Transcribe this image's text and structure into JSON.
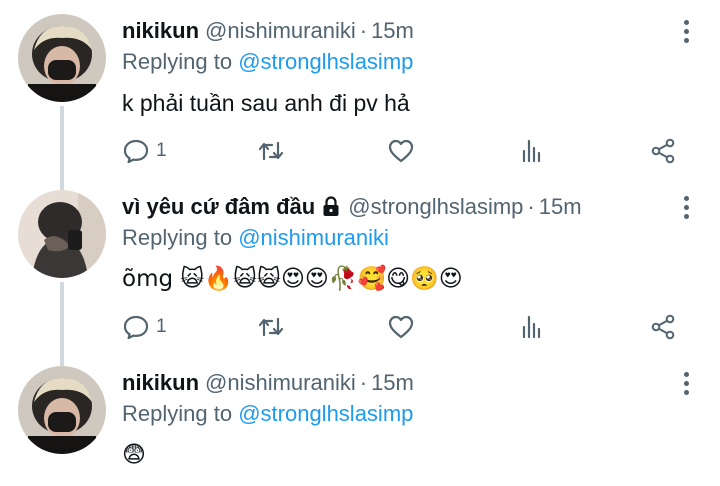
{
  "tweets": [
    {
      "name": "nikikun",
      "handle": "@nishimuraniki",
      "time": "15m",
      "replying_prefix": "Replying to",
      "replying_to": "@stronglhslasimp",
      "text": "k phải tuần sau anh đi pv hả",
      "reply_count": "1",
      "locked": false
    },
    {
      "name": "vì yêu cứ đâm đầu",
      "handle": "@stronglhslasimp",
      "time": "15m",
      "replying_prefix": "Replying to",
      "replying_to": "@nishimuraniki",
      "text": "õmg 🙀🔥🙀🙀😍😍🥀🥰😋🥺😍",
      "reply_count": "1",
      "locked": true
    },
    {
      "name": "nikikun",
      "handle": "@nishimuraniki",
      "time": "15m",
      "replying_prefix": "Replying to",
      "replying_to": "@stronglhslasimp",
      "text": "😨",
      "reply_count": "",
      "locked": false
    }
  ],
  "separator": "·",
  "colors": {
    "text": "#0f1419",
    "muted": "#536471",
    "link": "#1d9bf0",
    "thread_line": "#cfd9de"
  },
  "icons": [
    "reply-icon",
    "retweet-icon",
    "like-icon",
    "stats-icon",
    "share-icon",
    "more-options-icon",
    "lock-icon"
  ]
}
